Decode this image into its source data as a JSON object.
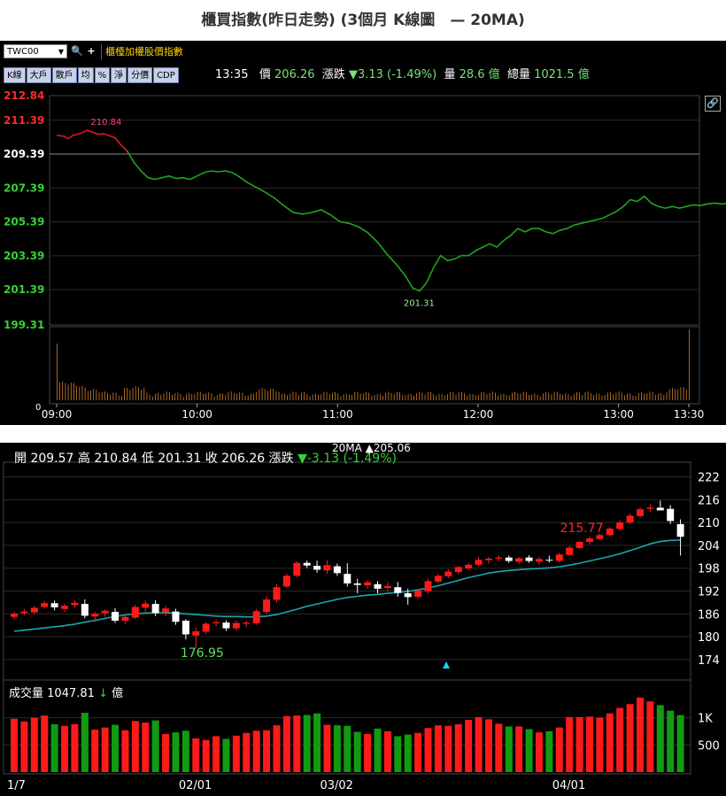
{
  "title": "櫃買指數(昨日走勢) (3個月 K線圖　— 20MA)",
  "colors": {
    "up": "#ff1a1a",
    "down": "#ffffff",
    "line_green": "#1fa51f",
    "line_red": "#e01616",
    "ma": "#1aa6b0",
    "vol_green": "#119b11",
    "vol_red": "#ff1a1a",
    "intraday_vol": "#d4802a"
  },
  "intraday": {
    "toolbar": {
      "code": "TWC00",
      "search_icon": "magnifier-icon",
      "add_icon": "plus-icon",
      "index_name": "櫃檯加權股價指數",
      "buttons": [
        "K線",
        "大戶",
        "散戶",
        "均",
        "%",
        "淨",
        "分價",
        "CDP"
      ]
    },
    "quote": {
      "time": "13:35",
      "price_label": "價",
      "price": "206.26",
      "change_label": "漲跌",
      "change": "▼3.13 (-1.49%)",
      "volume_label": "量",
      "volume": "28.6 億",
      "total_label": "總量",
      "total": "1021.5 億"
    },
    "link_icon": "link-icon",
    "chart_data": {
      "type": "line",
      "y_ticks": [
        "212.84",
        "211.39",
        "209.39",
        "207.39",
        "205.39",
        "203.39",
        "201.39",
        "199.31"
      ],
      "reference": 209.39,
      "ylim": [
        199.31,
        212.84
      ],
      "x_ticks": [
        "09:00",
        "10:00",
        "11:00",
        "12:00",
        "13:00",
        "13:30"
      ],
      "high_label": "210.84",
      "low_label": "201.31",
      "series": [
        {
          "points": [
            [
              0,
              210.5
            ],
            [
              3,
              210.45
            ],
            [
              5,
              210.3
            ],
            [
              7,
              210.5
            ],
            [
              10,
              210.6
            ],
            [
              13,
              210.8
            ],
            [
              15,
              210.7
            ],
            [
              18,
              210.55
            ],
            [
              20,
              210.6
            ],
            [
              22,
              210.5
            ],
            [
              25,
              210.35
            ],
            [
              27,
              210.0
            ],
            [
              30,
              209.6
            ],
            [
              33,
              208.9
            ],
            [
              36,
              208.4
            ],
            [
              39,
              208.0
            ],
            [
              42,
              207.9
            ],
            [
              45,
              208.0
            ],
            [
              48,
              208.1
            ],
            [
              51,
              207.95
            ],
            [
              54,
              208.0
            ],
            [
              57,
              207.9
            ],
            [
              60,
              208.1
            ],
            [
              63,
              208.3
            ],
            [
              66,
              208.4
            ],
            [
              69,
              208.35
            ],
            [
              72,
              208.4
            ],
            [
              75,
              208.3
            ],
            [
              78,
              208.05
            ],
            [
              81,
              207.75
            ],
            [
              85,
              207.45
            ],
            [
              89,
              207.15
            ],
            [
              93,
              206.8
            ],
            [
              97,
              206.35
            ],
            [
              101,
              205.95
            ],
            [
              105,
              205.85
            ],
            [
              109,
              205.95
            ],
            [
              113,
              206.1
            ],
            [
              117,
              205.8
            ],
            [
              121,
              205.4
            ],
            [
              125,
              205.3
            ],
            [
              129,
              205.1
            ],
            [
              133,
              204.75
            ],
            [
              137,
              204.2
            ],
            [
              141,
              203.5
            ],
            [
              145,
              202.9
            ],
            [
              149,
              202.2
            ],
            [
              152,
              201.5
            ],
            [
              155,
              201.31
            ],
            [
              158,
              201.8
            ],
            [
              161,
              202.7
            ],
            [
              164,
              203.4
            ],
            [
              167,
              203.1
            ],
            [
              170,
              203.2
            ],
            [
              173,
              203.4
            ],
            [
              176,
              203.4
            ],
            [
              179,
              203.7
            ],
            [
              182,
              203.9
            ],
            [
              185,
              204.1
            ],
            [
              188,
              203.9
            ],
            [
              191,
              204.3
            ],
            [
              194,
              204.6
            ],
            [
              197,
              205.0
            ],
            [
              200,
              204.8
            ],
            [
              203,
              205.0
            ],
            [
              206,
              205.0
            ],
            [
              209,
              204.8
            ],
            [
              212,
              204.7
            ],
            [
              215,
              204.9
            ],
            [
              218,
              205.0
            ],
            [
              221,
              205.2
            ],
            [
              224,
              205.3
            ],
            [
              227,
              205.4
            ],
            [
              230,
              205.5
            ],
            [
              233,
              205.6
            ],
            [
              236,
              205.8
            ],
            [
              239,
              206.0
            ],
            [
              242,
              206.3
            ],
            [
              245,
              206.7
            ],
            [
              248,
              206.6
            ],
            [
              251,
              206.9
            ],
            [
              254,
              206.5
            ],
            [
              257,
              206.3
            ],
            [
              260,
              206.2
            ],
            [
              263,
              206.3
            ],
            [
              266,
              206.2
            ],
            [
              269,
              206.3
            ],
            [
              272,
              206.4
            ],
            [
              275,
              206.35
            ],
            [
              278,
              206.45
            ],
            [
              281,
              206.5
            ],
            [
              284,
              206.45
            ],
            [
              287,
              206.5
            ],
            [
              290,
              206.46
            ]
          ]
        }
      ],
      "x_range_minutes": [
        0,
        270
      ]
    }
  },
  "daily": {
    "ohlc": {
      "open_label": "開",
      "open": "209.57",
      "high_label": "高",
      "high": "210.84",
      "low_label": "低",
      "low": "201.31",
      "close_label": "收",
      "close": "206.26",
      "change_label": "漲跌",
      "change": "▼-3.13 (-1.49%)"
    },
    "ma_label": "20MA",
    "ma_value": "▲205.06",
    "volume_label": "成交量",
    "volume_value": "1047.81",
    "volume_unit": "億",
    "volume_arrow": "↓",
    "chart_data": {
      "type": "candlestick",
      "y_ticks": [
        "222",
        "216",
        "210",
        "204",
        "198",
        "192",
        "186",
        "180",
        "174"
      ],
      "ylim": [
        170,
        224
      ],
      "vol_ticks": [
        "1K",
        "500"
      ],
      "vol_lim": [
        0,
        1400
      ],
      "x_labels": [
        {
          "index": 0,
          "label": "1/7"
        },
        {
          "index": 17,
          "label": "02/01"
        },
        {
          "index": 31,
          "label": "03/02"
        },
        {
          "index": 54,
          "label": "04/01"
        }
      ],
      "annotations": [
        {
          "index": 56,
          "label": "215.77",
          "kind": "high"
        },
        {
          "index": 17,
          "label": "176.95",
          "kind": "low"
        }
      ],
      "candles": [
        {
          "o": 185.2,
          "h": 186.5,
          "l": 184.6,
          "c": 186.0,
          "v": 980
        },
        {
          "o": 186.2,
          "h": 187.3,
          "l": 185.6,
          "c": 186.6,
          "v": 930
        },
        {
          "o": 186.4,
          "h": 188.1,
          "l": 185.8,
          "c": 187.6,
          "v": 1000
        },
        {
          "o": 187.8,
          "h": 189.4,
          "l": 187.3,
          "c": 188.8,
          "v": 1040
        },
        {
          "o": 188.8,
          "h": 189.5,
          "l": 186.9,
          "c": 187.7,
          "v": 880
        },
        {
          "o": 187.3,
          "h": 188.7,
          "l": 186.5,
          "c": 188.1,
          "v": 850
        },
        {
          "o": 188.3,
          "h": 189.7,
          "l": 187.4,
          "c": 188.9,
          "v": 880
        },
        {
          "o": 188.6,
          "h": 189.8,
          "l": 184.8,
          "c": 185.5,
          "v": 1090
        },
        {
          "o": 185.3,
          "h": 186.6,
          "l": 183.9,
          "c": 186.0,
          "v": 780
        },
        {
          "o": 186.2,
          "h": 187.2,
          "l": 185.2,
          "c": 186.8,
          "v": 820
        },
        {
          "o": 186.5,
          "h": 187.5,
          "l": 183.6,
          "c": 184.2,
          "v": 870
        },
        {
          "o": 184.2,
          "h": 185.7,
          "l": 183.3,
          "c": 185.2,
          "v": 770
        },
        {
          "o": 185.0,
          "h": 188.4,
          "l": 184.6,
          "c": 187.8,
          "v": 940
        },
        {
          "o": 187.6,
          "h": 189.5,
          "l": 186.4,
          "c": 188.7,
          "v": 910
        },
        {
          "o": 188.6,
          "h": 189.6,
          "l": 185.4,
          "c": 186.2,
          "v": 950
        },
        {
          "o": 186.4,
          "h": 188.2,
          "l": 185.4,
          "c": 187.4,
          "v": 700
        },
        {
          "o": 186.6,
          "h": 187.3,
          "l": 183.1,
          "c": 183.9,
          "v": 730
        },
        {
          "o": 184.2,
          "h": 184.6,
          "l": 179.3,
          "c": 180.6,
          "v": 760
        },
        {
          "o": 180.3,
          "h": 182.4,
          "l": 176.95,
          "c": 181.4,
          "v": 620
        },
        {
          "o": 181.3,
          "h": 183.8,
          "l": 180.6,
          "c": 183.4,
          "v": 590
        },
        {
          "o": 183.5,
          "h": 184.5,
          "l": 182.7,
          "c": 183.8,
          "v": 660
        },
        {
          "o": 183.7,
          "h": 184.3,
          "l": 181.5,
          "c": 182.2,
          "v": 610
        },
        {
          "o": 182.2,
          "h": 184.3,
          "l": 181.6,
          "c": 183.6,
          "v": 670
        },
        {
          "o": 183.4,
          "h": 184.3,
          "l": 182.6,
          "c": 183.7,
          "v": 720
        },
        {
          "o": 183.5,
          "h": 187.3,
          "l": 183.1,
          "c": 186.7,
          "v": 760
        },
        {
          "o": 186.5,
          "h": 190.6,
          "l": 186.0,
          "c": 189.8,
          "v": 770
        },
        {
          "o": 189.7,
          "h": 193.9,
          "l": 189.0,
          "c": 193.0,
          "v": 860
        },
        {
          "o": 193.2,
          "h": 196.6,
          "l": 192.8,
          "c": 196.0,
          "v": 1030
        },
        {
          "o": 196.0,
          "h": 199.8,
          "l": 195.6,
          "c": 199.4,
          "v": 1040
        },
        {
          "o": 199.4,
          "h": 200.0,
          "l": 198.0,
          "c": 198.7,
          "v": 1050
        },
        {
          "o": 198.6,
          "h": 200.0,
          "l": 196.8,
          "c": 197.6,
          "v": 1080
        },
        {
          "o": 197.4,
          "h": 200.1,
          "l": 196.6,
          "c": 198.8,
          "v": 870
        },
        {
          "o": 198.5,
          "h": 199.2,
          "l": 196.0,
          "c": 196.7,
          "v": 860
        },
        {
          "o": 196.5,
          "h": 199.3,
          "l": 193.2,
          "c": 194.0,
          "v": 850
        },
        {
          "o": 194.0,
          "h": 195.2,
          "l": 191.4,
          "c": 193.6,
          "v": 740
        },
        {
          "o": 193.5,
          "h": 194.8,
          "l": 192.5,
          "c": 194.3,
          "v": 700
        },
        {
          "o": 193.8,
          "h": 194.6,
          "l": 191.4,
          "c": 192.6,
          "v": 800
        },
        {
          "o": 192.8,
          "h": 194.4,
          "l": 191.8,
          "c": 193.3,
          "v": 750
        },
        {
          "o": 193.0,
          "h": 194.4,
          "l": 190.5,
          "c": 191.5,
          "v": 660
        },
        {
          "o": 191.4,
          "h": 192.6,
          "l": 188.4,
          "c": 190.4,
          "v": 690
        },
        {
          "o": 190.5,
          "h": 192.6,
          "l": 189.9,
          "c": 192.1,
          "v": 720
        },
        {
          "o": 191.9,
          "h": 195.3,
          "l": 191.3,
          "c": 194.6,
          "v": 810
        },
        {
          "o": 194.5,
          "h": 196.5,
          "l": 194.0,
          "c": 196.0,
          "v": 860
        },
        {
          "o": 195.9,
          "h": 197.7,
          "l": 195.4,
          "c": 197.1,
          "v": 850
        },
        {
          "o": 197.0,
          "h": 198.6,
          "l": 196.4,
          "c": 198.3,
          "v": 880
        },
        {
          "o": 198.0,
          "h": 199.5,
          "l": 197.5,
          "c": 198.9,
          "v": 960
        },
        {
          "o": 198.9,
          "h": 200.9,
          "l": 198.5,
          "c": 200.2,
          "v": 1010
        },
        {
          "o": 200.1,
          "h": 201.0,
          "l": 199.1,
          "c": 200.5,
          "v": 970
        },
        {
          "o": 200.5,
          "h": 201.4,
          "l": 199.8,
          "c": 200.8,
          "v": 890
        },
        {
          "o": 200.8,
          "h": 201.3,
          "l": 199.4,
          "c": 199.9,
          "v": 840
        },
        {
          "o": 199.7,
          "h": 200.9,
          "l": 199.1,
          "c": 200.6,
          "v": 840
        },
        {
          "o": 200.8,
          "h": 201.4,
          "l": 199.4,
          "c": 199.9,
          "v": 790
        },
        {
          "o": 199.7,
          "h": 201.0,
          "l": 198.9,
          "c": 200.4,
          "v": 730
        },
        {
          "o": 200.2,
          "h": 201.3,
          "l": 199.5,
          "c": 200.0,
          "v": 750
        },
        {
          "o": 199.9,
          "h": 202.0,
          "l": 199.5,
          "c": 201.6,
          "v": 820
        },
        {
          "o": 201.5,
          "h": 203.8,
          "l": 201.2,
          "c": 203.4,
          "v": 1010
        },
        {
          "o": 203.3,
          "h": 205.2,
          "l": 203.0,
          "c": 204.9,
          "v": 1010
        },
        {
          "o": 204.9,
          "h": 206.3,
          "l": 204.2,
          "c": 205.8,
          "v": 1020
        },
        {
          "o": 205.7,
          "h": 207.2,
          "l": 205.4,
          "c": 206.7,
          "v": 1000
        },
        {
          "o": 206.7,
          "h": 208.8,
          "l": 206.3,
          "c": 208.4,
          "v": 1080
        },
        {
          "o": 208.3,
          "h": 210.5,
          "l": 207.9,
          "c": 210.0,
          "v": 1180
        },
        {
          "o": 210.0,
          "h": 212.4,
          "l": 209.6,
          "c": 211.8,
          "v": 1250
        },
        {
          "o": 211.7,
          "h": 214.0,
          "l": 211.2,
          "c": 213.5,
          "v": 1370
        },
        {
          "o": 213.6,
          "h": 214.8,
          "l": 212.8,
          "c": 213.9,
          "v": 1300
        },
        {
          "o": 213.9,
          "h": 215.77,
          "l": 213.5,
          "c": 213.2,
          "v": 1230
        },
        {
          "o": 213.6,
          "h": 214.6,
          "l": 209.6,
          "c": 210.4,
          "v": 1130
        },
        {
          "o": 209.57,
          "h": 210.84,
          "l": 201.31,
          "c": 206.26,
          "v": 1047.81
        }
      ],
      "ma20": [
        181.4,
        181.7,
        182.0,
        182.3,
        182.6,
        182.9,
        183.3,
        183.8,
        184.3,
        184.8,
        185.3,
        185.7,
        186.0,
        186.2,
        186.3,
        186.3,
        186.2,
        186.0,
        185.8,
        185.6,
        185.4,
        185.3,
        185.3,
        185.2,
        185.2,
        185.4,
        185.8,
        186.5,
        187.2,
        188.0,
        188.6,
        189.2,
        189.8,
        190.3,
        190.6,
        190.9,
        191.1,
        191.4,
        191.6,
        191.9,
        192.3,
        192.8,
        193.4,
        194.1,
        194.8,
        195.5,
        196.1,
        196.7,
        197.1,
        197.4,
        197.6,
        197.8,
        197.9,
        198.1,
        198.4,
        198.8,
        199.3,
        199.9,
        200.5,
        201.1,
        201.8,
        202.6,
        203.5,
        204.4,
        205.0,
        205.3,
        205.4
      ]
    }
  }
}
